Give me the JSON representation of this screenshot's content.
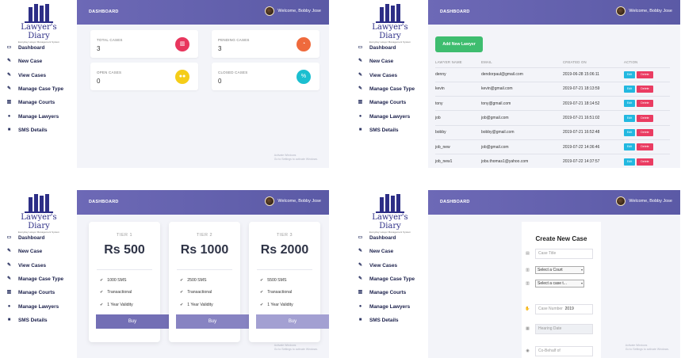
{
  "app": {
    "logo_name": "Lawyer's Diary",
    "logo_tagline": "Everyday Lawyer Management System",
    "header_title": "DASHBOARD",
    "welcome": "Welcome, Bobby Jose",
    "watermark_line1": "Activate Windows",
    "watermark_line2": "Go to Settings to activate Windows."
  },
  "sidebar": {
    "items": [
      {
        "label": "Dashboard",
        "icon": "monitor-icon"
      },
      {
        "label": "New Case",
        "icon": "edit-icon"
      },
      {
        "label": "View Cases",
        "icon": "edit-icon"
      },
      {
        "label": "Manage Case Type",
        "icon": "edit-icon"
      },
      {
        "label": "Manage Courts",
        "icon": "building-icon"
      },
      {
        "label": "Manage Lawyers",
        "icon": "users-icon"
      },
      {
        "label": "SMS Details",
        "icon": "comment-icon"
      }
    ]
  },
  "dashboard": {
    "stats": [
      {
        "label": "TOTAL CASES",
        "value": "3",
        "color": "#e8365d",
        "icon": "chart-icon"
      },
      {
        "label": "PENDING CASES",
        "value": "3",
        "color": "#ef6a3c",
        "icon": "pie-icon"
      },
      {
        "label": "OPEN CASES",
        "value": "0",
        "color": "#f5cd18",
        "icon": "group-icon"
      },
      {
        "label": "CLOSED CASES",
        "value": "0",
        "color": "#1bbfd0",
        "icon": "percent-icon"
      }
    ]
  },
  "lawyers": {
    "add_button": "Add New Lawyer",
    "columns": [
      "LAWYER NAME",
      "EMAIL",
      "CREATED ON",
      "ACTION"
    ],
    "edit_label": "Edit",
    "delete_label": "Delete",
    "rows": [
      {
        "name": "denny",
        "email": "dendorpaul@gmail.com",
        "created": "2019-06-28 15:06:11"
      },
      {
        "name": "kevin",
        "email": "kevin@gmail.com",
        "created": "2019-07-21 18:13:59"
      },
      {
        "name": "tony",
        "email": "tony@gmail.com",
        "created": "2019-07-21 18:14:52"
      },
      {
        "name": "job",
        "email": "job@gmail.com",
        "created": "2019-07-21 16:51:02"
      },
      {
        "name": "bobby",
        "email": "bobby@gmail.com",
        "created": "2019-07-21 16:52:48"
      },
      {
        "name": "job_new",
        "email": "job@gmail.com",
        "created": "2019-07-22 14:36:46"
      },
      {
        "name": "job_new1",
        "email": "jobs.thomas1@yahoo.com",
        "created": "2019-07-22 14:37:57"
      }
    ]
  },
  "pricing": {
    "buy_label": "Buy",
    "tiers": [
      {
        "name": "TIER 1",
        "price": "Rs 500",
        "features": [
          "1000 SMS",
          "Transactional",
          "1 Year Validity"
        ],
        "button_color": "#736fb5"
      },
      {
        "name": "TIER 2",
        "price": "Rs 1000",
        "features": [
          "2500 SMS",
          "Transactional",
          "1 Year Validity"
        ],
        "button_color": "#8783c2"
      },
      {
        "name": "TIER 3",
        "price": "Rs 2000",
        "features": [
          "5500 SMS",
          "Transactional",
          "1 Year Validity"
        ],
        "button_color": "#a3a0d2"
      }
    ]
  },
  "new_case": {
    "title": "Create New Case",
    "case_title_placeholder": "Case Title",
    "court_select": "Select a Court",
    "case_type_select": "Select a case t...",
    "case_number_placeholder": "Case Number",
    "case_year": "2019",
    "hearing_date_placeholder": "Hearing Date",
    "co_behalf_placeholder": "Co-Behalf of"
  }
}
